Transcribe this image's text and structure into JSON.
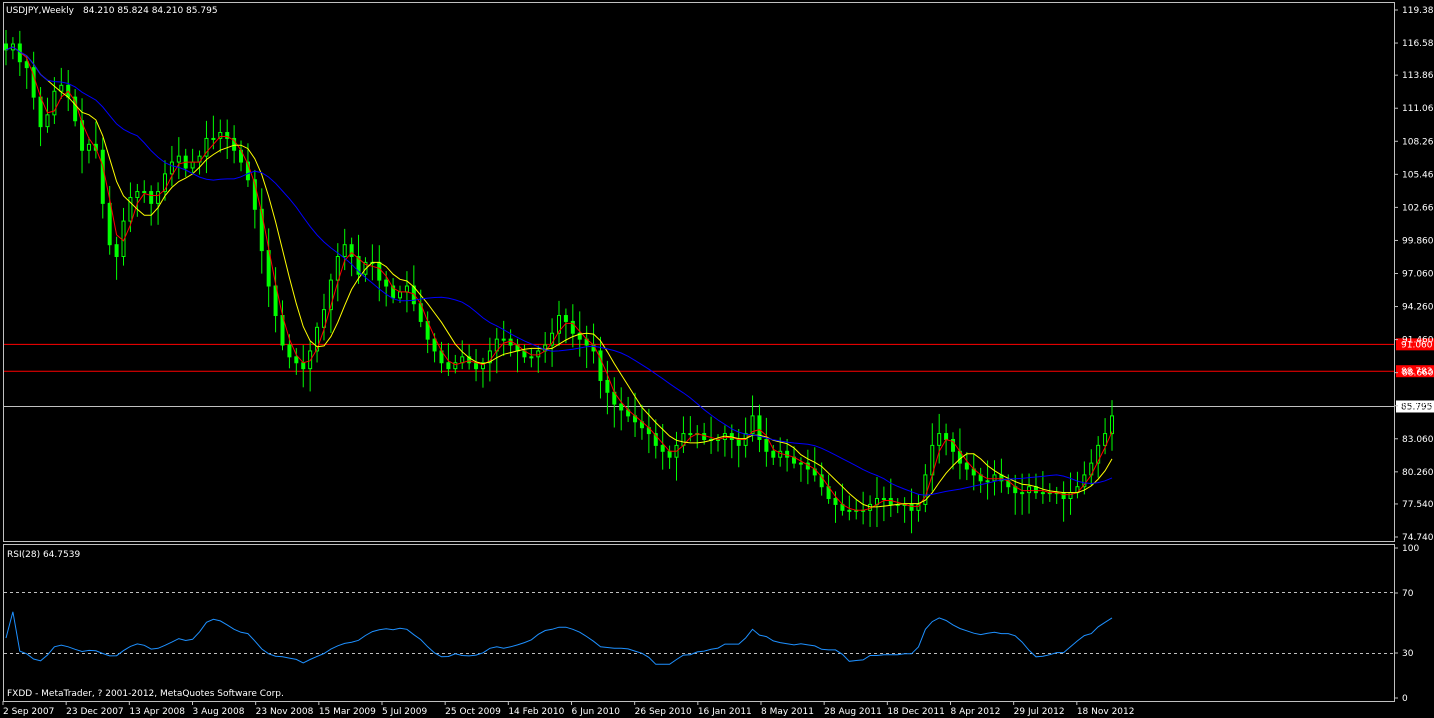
{
  "header": {
    "symbol_label": "USDJPY,Weekly",
    "ohlc_label": "84.210 85.824 84.210 85.795"
  },
  "rsi_panel": {
    "label": "RSI(28) 64.7539",
    "levels": [
      30,
      70
    ],
    "ticks": [
      "100",
      "70",
      "30",
      "0"
    ]
  },
  "footer": {
    "copyright": "FXDD - MetaTrader, ? 2001-2012, MetaQuotes Software Corp."
  },
  "colors": {
    "background": "#000000",
    "grid": "#c0c0c0",
    "candle": "#00ff00",
    "ma_fast": "#ff0000",
    "ma_mid": "#ffff00",
    "ma_slow": "#0000ff",
    "rsi": "#1e90ff",
    "hline": "#ff0000",
    "price_line": "#c0c0c0"
  },
  "chart_data": {
    "type": "line",
    "title": "USDJPY,Weekly",
    "ylim": [
      74.74,
      119.38
    ],
    "y_ticks": [
      "119.380",
      "116.580",
      "113.860",
      "111.060",
      "108.260",
      "105.460",
      "102.660",
      "99.860",
      "97.060",
      "94.260",
      "91.460",
      "88.660",
      "85.860",
      "83.060",
      "80.260",
      "77.540",
      "74.740"
    ],
    "x_ticks": [
      "2 Sep 2007",
      "23 Dec 2007",
      "13 Apr 2008",
      "3 Aug 2008",
      "23 Nov 2008",
      "15 Mar 2009",
      "5 Jul 2009",
      "25 Oct 2009",
      "14 Feb 2010",
      "6 Jun 2010",
      "26 Sep 2010",
      "16 Jan 2011",
      "8 May 2011",
      "28 Aug 2011",
      "18 Dec 2011",
      "8 Apr 2012",
      "29 Jul 2012",
      "18 Nov 2012"
    ],
    "horizontal_lines": [
      {
        "label": "91.060",
        "value": 91.06
      },
      {
        "label": "88.783",
        "value": 88.783
      }
    ],
    "current_price": {
      "label": "85.795",
      "value": 85.795
    },
    "series": [
      {
        "values": [
          116.0,
          116.5,
          115.0,
          114.5,
          112.0,
          109.5,
          110.5,
          112.5,
          113.0,
          112.0,
          110.0,
          107.5,
          108.0,
          107.5,
          103.0,
          99.5,
          98.5,
          101.5,
          103.5,
          104.0,
          104.0,
          103.0,
          104.0,
          105.5,
          106.5,
          107.0,
          106.0,
          106.5,
          107.0,
          108.5,
          108.5,
          109.0,
          108.5,
          107.5,
          106.5,
          105.0,
          102.5,
          99.0,
          96.0,
          93.5,
          91.0,
          90.0,
          89.5,
          89.0,
          90.5,
          92.5,
          94.0,
          96.5,
          98.5,
          99.5,
          98.5,
          97.0,
          98.0,
          98.0,
          96.5,
          96.0,
          95.0,
          95.5,
          96.0,
          94.5,
          93.0,
          91.5,
          90.5,
          89.5,
          89.0,
          89.5,
          90.0,
          89.5,
          89.0,
          89.5,
          90.5,
          91.5,
          91.5,
          91.0,
          90.5,
          90.0,
          90.0,
          90.5,
          91.0,
          92.0,
          93.5,
          93.0,
          92.0,
          91.5,
          91.0,
          90.5,
          88.0,
          87.0,
          86.0,
          85.5,
          85.0,
          84.5,
          84.0,
          83.5,
          82.5,
          82.0,
          81.5,
          82.5,
          83.5,
          83.5,
          83.5,
          83.0,
          83.0,
          83.0,
          83.5,
          83.0,
          82.5,
          83.5,
          85.0,
          83.0,
          82.0,
          81.5,
          82.0,
          81.5,
          81.0,
          81.0,
          80.5,
          80.0,
          79.0,
          78.0,
          77.5,
          77.0,
          77.0,
          77.0,
          77.0,
          77.5,
          78.0,
          78.0,
          77.5,
          77.5,
          77.5,
          77.0,
          77.5,
          80.0,
          82.5,
          83.5,
          83.0,
          82.0,
          81.0,
          80.5,
          80.0,
          79.5,
          79.5,
          80.0,
          79.5,
          79.0,
          78.5,
          78.5,
          79.0,
          78.5,
          78.5,
          78.5,
          78.5,
          78.0,
          78.5,
          79.0,
          80.0,
          81.0,
          82.5,
          83.5,
          85.0
        ]
      }
    ],
    "rsi_ylim": [
      0,
      100
    ]
  }
}
